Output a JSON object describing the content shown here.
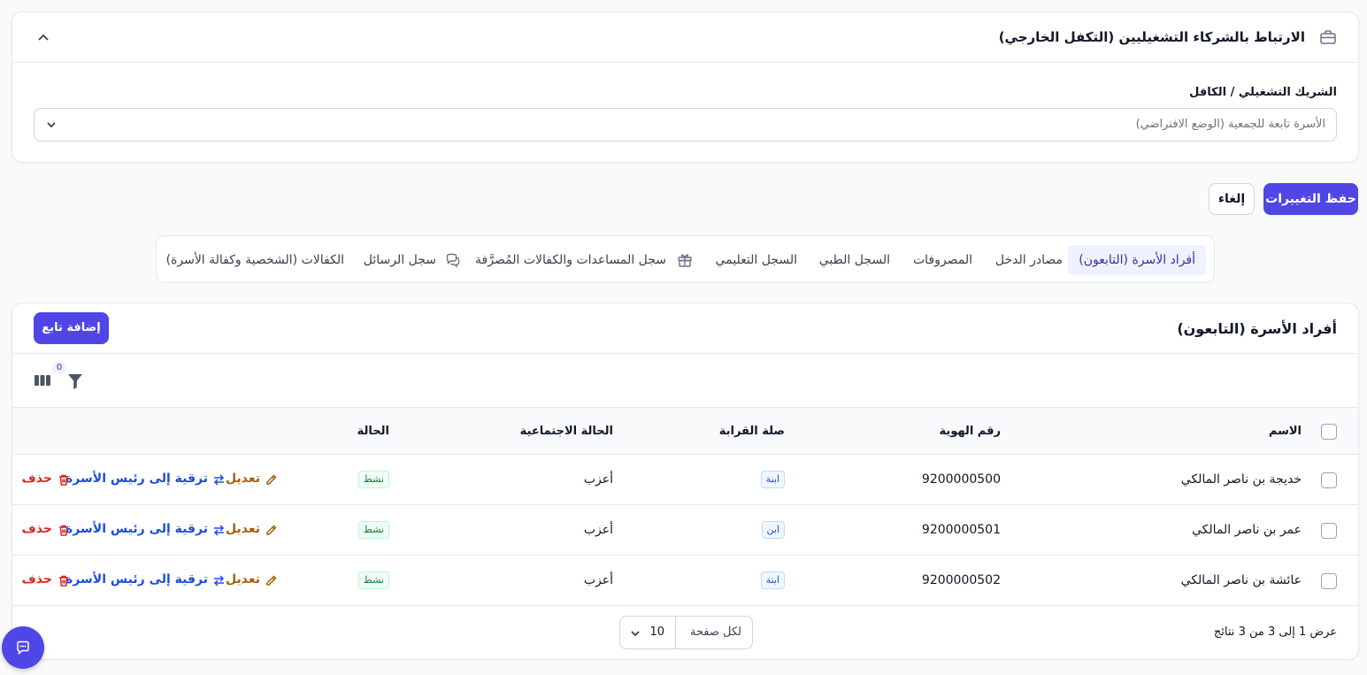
{
  "partner_section": {
    "title": "الارتباط بالشركاء التشغيليين (التكفل الخارجي)",
    "field_label": "الشريك التشغيلي / الكافل",
    "field_value": "الأسرة تابعة للجمعية (الوضع الافتراضي)"
  },
  "actions": {
    "save": "حفظ التغييرات",
    "cancel": "إلغاء"
  },
  "tabs": [
    {
      "label": "أفراد الأسرة (التابعون)",
      "active": true
    },
    {
      "label": "مصادر الدخل"
    },
    {
      "label": "المصروفات"
    },
    {
      "label": "السجل الطبي"
    },
    {
      "label": "السجل التعليمي"
    },
    {
      "label": "سجل المساعدات والكفالات المُصرَّفة",
      "icon": "gift-icon"
    },
    {
      "label": "سجل الرسائل",
      "icon": "chat-bubbles-icon"
    },
    {
      "label": "الكفالات (الشخصية وكفالة الأسرة)"
    }
  ],
  "members": {
    "title": "أفراد الأسرة (التابعون)",
    "add_button": "إضافة تابع",
    "filter_count": "0",
    "columns": {
      "name": "الاسم",
      "id_number": "رقم الهوية",
      "relation": "صلة القرابة",
      "marital_status": "الحالة الاجتماعية",
      "status": "الحالة"
    },
    "rows": [
      {
        "name": "خديجة بن ناصر المالكي",
        "id_number": "9200000500",
        "relation": "ابنة",
        "marital_status": "أعزب",
        "status": "نشط"
      },
      {
        "name": "عمر بن ناصر المالكي",
        "id_number": "9200000501",
        "relation": "ابن",
        "marital_status": "أعزب",
        "status": "نشط"
      },
      {
        "name": "عائشة بن ناصر المالكي",
        "id_number": "9200000502",
        "relation": "ابنة",
        "marital_status": "أعزب",
        "status": "نشط"
      }
    ],
    "row_actions": {
      "edit": "تعديل",
      "promote": "ترقية إلى رئيس الأسرة",
      "delete": "حذف"
    },
    "footer": {
      "summary": "عرض 1 إلى 3 من 3 نتائج",
      "per_page_label": "لكل صفحة",
      "per_page_value": "10"
    }
  },
  "colors": {
    "primary": "#4f46e5",
    "edit": "#a16207",
    "promote": "#1d4ed8",
    "delete": "#dc2626",
    "status_active": "#15803d"
  }
}
